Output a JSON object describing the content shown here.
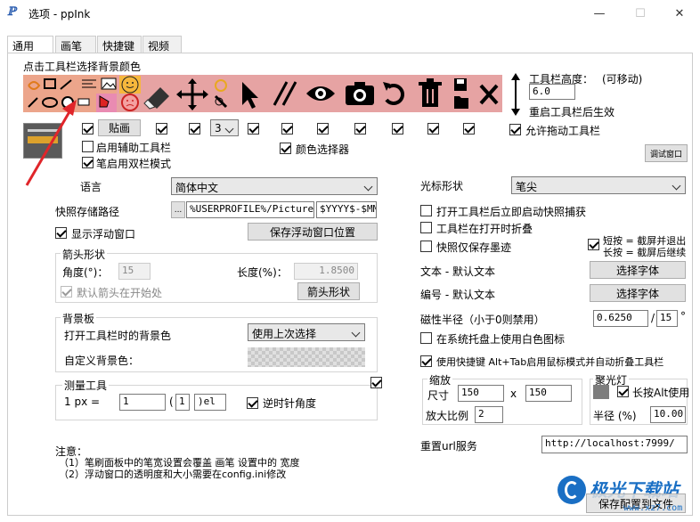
{
  "window": {
    "title": "选项 - ppInk",
    "app_icon": "ℙ",
    "minimize": "—",
    "maximize": "☐",
    "close": "✕"
  },
  "tabs": [
    {
      "label": "通用",
      "active": true
    },
    {
      "label": "画笔"
    },
    {
      "label": "快捷键"
    },
    {
      "label": "视频"
    }
  ],
  "general": {
    "toolbar_bg_label": "点击工具栏选择背景颜色",
    "toolbar_height_label": "工具栏高度：",
    "toolbar_height_movable": "(可移动)",
    "toolbar_height_value": "6.0",
    "restart_note": "重启工具栏后生效",
    "allow_drag_toolbar": "允许拖动工具栏",
    "debug_window": "调试窗口",
    "paste_button": "贴画",
    "pen_count_value": "3",
    "enable_aux_toolbar": "启用辅助工具栏",
    "pen_double_column": "笔启用双栏模式",
    "color_picker": "颜色选择器"
  },
  "left": {
    "language_label": "语言",
    "language_value": "简体中文",
    "snapshot_path_label": "快照存储路径",
    "snapshot_path_button": "...",
    "snapshot_path_value": "%USERPROFILE%/Pictures/",
    "snapshot_name_value": "$YYYY$-$MM$",
    "show_float_window": "显示浮动窗口",
    "save_float_pos": "保存浮动窗口位置",
    "arrow_shape_title": "箭头形状",
    "angle_label": "角度(°)：",
    "angle_value": "15",
    "length_label": "长度(%)：",
    "length_value": "1.8500",
    "default_arrow_at_start": "默认箭头在开始处",
    "arrow_shape_button": "箭头形状",
    "bg_title": "背景板",
    "bg_open_label": "打开工具栏时的背景色",
    "bg_open_value": "使用上次选择",
    "custom_bg_label": "自定义背景色：",
    "measure_title": "测量工具",
    "px_label": "1 px =",
    "px_value": "1",
    "paren_open": "(",
    "paren_value": "1",
    "unit_value": ")el",
    "ccw_angle": "逆时针角度"
  },
  "right": {
    "cursor_label": "光标形状",
    "cursor_value": "笔尖",
    "open_snapshot": "打开工具栏后立即启动快照捕获",
    "fold_on_open": "工具栏在打开时折叠",
    "snapshot_ink_only": "快照仅保存墨迹",
    "short_press": "短按 = 截屏并退出",
    "long_press": "长按 = 截屏后继续",
    "text_label": "文本  - 默认文本",
    "select_font_1": "选择字体",
    "number_label": "编号  - 默认文本",
    "select_font_2": "选择字体",
    "magnet_label": "磁性半径（小于0则禁用）",
    "magnet_value": "0.6250",
    "magnet_slash": "/",
    "magnet_value2": "15",
    "magnet_unit": "°",
    "white_tray_icon": "在系统托盘上使用白色图标",
    "alt_tab_mouse": "使用快捷键 Alt+Tab启用鼠标模式并自动折叠工具栏",
    "zoom_title": "缩放",
    "size_label": "尺寸",
    "size_w": "150",
    "size_x": "x",
    "size_h": "150",
    "zoom_ratio_label": "放大比例",
    "zoom_ratio_value": "2",
    "spotlight_title": "聚光灯",
    "long_press_alt": "长按Alt使用",
    "radius_label": "半径 (%)",
    "radius_value": "10.00",
    "reset_url_label": "重置url服务",
    "reset_url_value": "http://localhost:7999/",
    "save_config": "保存配置到文件"
  },
  "notes": {
    "title": "注意：",
    "line1": "（1）笔刷面板中的笔宽设置会覆盖 画笔 设置中的 宽度",
    "line2": "（2）浮动窗口的透明度和大小需要在config.ini修改"
  },
  "watermark": {
    "text": "极光下载站",
    "url": "www.xz7.com"
  },
  "colors": {
    "toolbar_bg": "#e6a3a3",
    "accent_arrow": "#e0252a",
    "watermark_blue": "#1a6fc4"
  }
}
